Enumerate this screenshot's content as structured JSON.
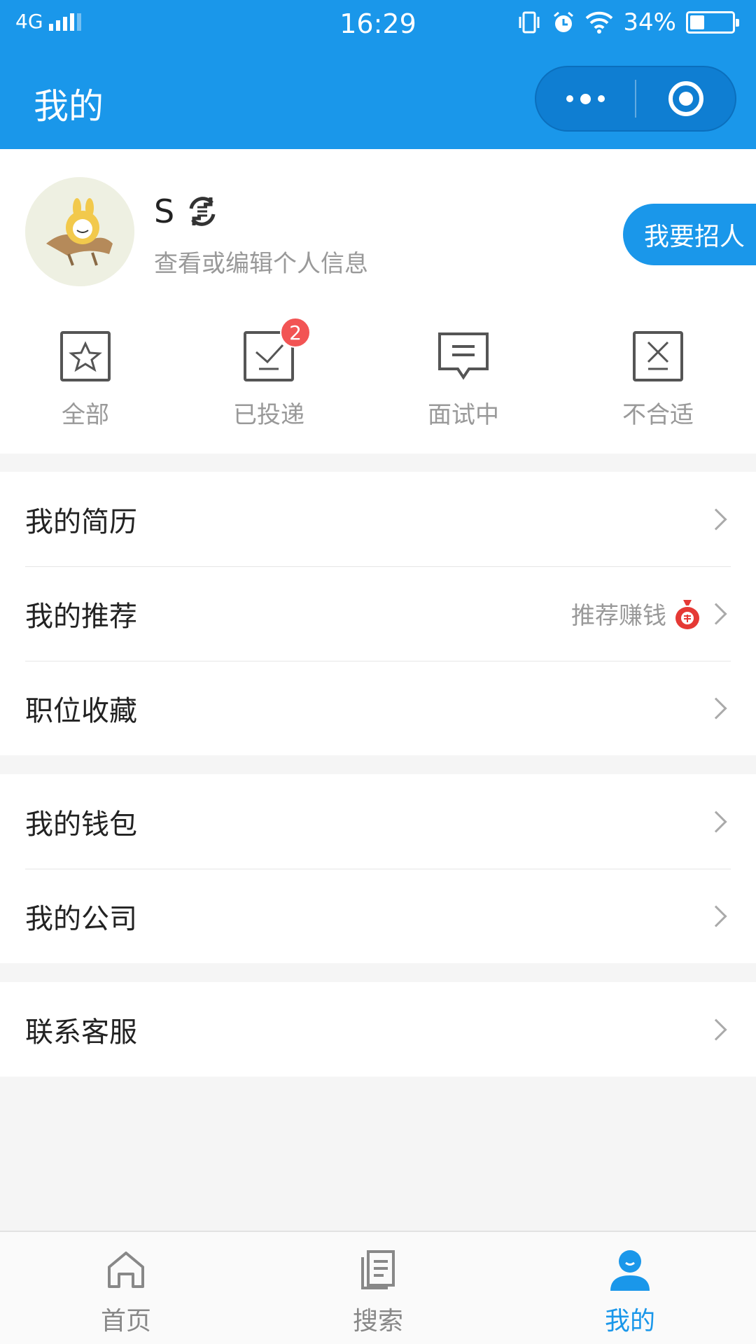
{
  "status_bar": {
    "network": "4G",
    "time": "16:29",
    "battery": "34%",
    "battery_level": 0.34
  },
  "nav": {
    "title": "我的",
    "more_icon": "more-dots-icon",
    "close_icon": "target-circle-icon"
  },
  "profile": {
    "name": "S",
    "subtitle": "查看或编辑个人信息",
    "recruit_label": "我要招人"
  },
  "stats": [
    {
      "label": "全部",
      "icon": "star-icon"
    },
    {
      "label": "已投递",
      "icon": "check-icon",
      "badge": "2"
    },
    {
      "label": "面试中",
      "icon": "message-icon"
    },
    {
      "label": "不合适",
      "icon": "x-icon"
    }
  ],
  "menu": {
    "group1": [
      {
        "label": "我的简历"
      },
      {
        "label": "我的推荐",
        "tag": "推荐赚钱",
        "tag_icon": "money-bag-icon"
      },
      {
        "label": "职位收藏"
      }
    ],
    "group2": [
      {
        "label": "我的钱包"
      },
      {
        "label": "我的公司"
      }
    ],
    "group3": [
      {
        "label": "联系客服"
      }
    ]
  },
  "tabbar": [
    {
      "label": "首页",
      "icon": "home-icon"
    },
    {
      "label": "搜索",
      "icon": "document-icon"
    },
    {
      "label": "我的",
      "icon": "user-icon",
      "active": true
    }
  ],
  "colors": {
    "primary": "#1a97ea",
    "badge": "#f25454",
    "background": "#f5f5f5"
  }
}
